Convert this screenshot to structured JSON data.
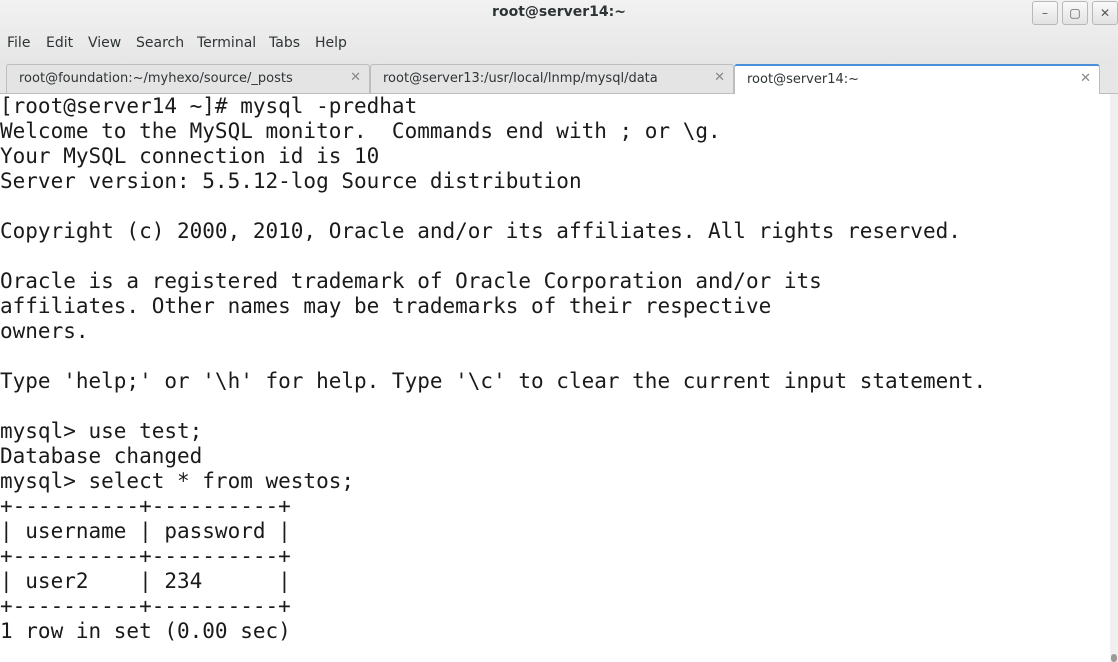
{
  "window": {
    "title": "root@server14:~",
    "minimize_label": "–",
    "maximize_label": "▢",
    "close_label": "✕"
  },
  "menu": {
    "items": [
      "File",
      "Edit",
      "View",
      "Search",
      "Terminal",
      "Tabs",
      "Help"
    ]
  },
  "tabs": [
    {
      "label": "root@foundation:~/myhexo/source/_posts",
      "close": "✕"
    },
    {
      "label": "root@server13:/usr/local/lnmp/mysql/data",
      "close": "✕"
    },
    {
      "label": "root@server14:~",
      "close": "✕"
    }
  ],
  "terminal": {
    "lines": [
      "[root@server14 ~]# mysql -predhat",
      "Welcome to the MySQL monitor.  Commands end with ; or \\g.",
      "Your MySQL connection id is 10",
      "Server version: 5.5.12-log Source distribution",
      "",
      "Copyright (c) 2000, 2010, Oracle and/or its affiliates. All rights reserved.",
      "",
      "Oracle is a registered trademark of Oracle Corporation and/or its",
      "affiliates. Other names may be trademarks of their respective",
      "owners.",
      "",
      "Type 'help;' or '\\h' for help. Type '\\c' to clear the current input statement.",
      "",
      "mysql> use test;",
      "Database changed",
      "mysql> select * from westos;",
      "+----------+----------+",
      "| username | password |",
      "+----------+----------+",
      "| user2    | 234      |",
      "+----------+----------+",
      "1 row in set (0.00 sec)"
    ]
  }
}
